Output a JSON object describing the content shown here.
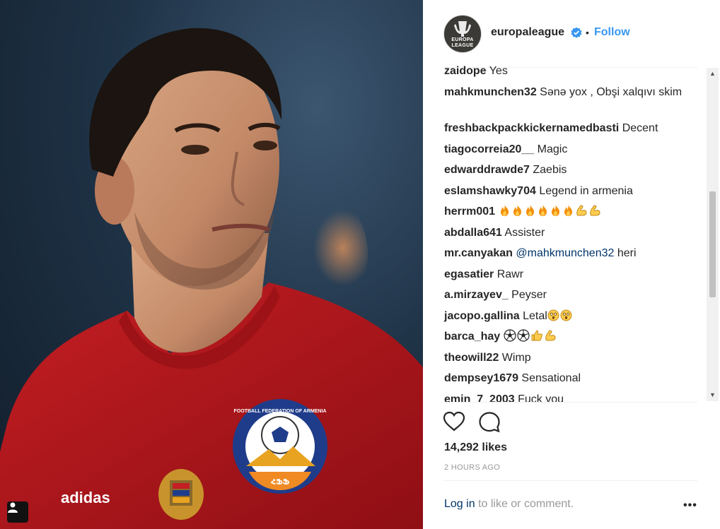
{
  "post": {
    "username": "europaleague",
    "avatar_text": [
      "EUROPA",
      "LEAGUE"
    ],
    "separator": "•",
    "follow_label": "Follow",
    "likes": "14,292 likes",
    "time": "2 HOURS AGO",
    "login_link": "Log in",
    "login_rest": " to like or comment.",
    "more_label": "•••"
  },
  "comments": [
    {
      "user": "zaidope",
      "text": " Yes"
    },
    {
      "user": "mahkmunchen32",
      "text": " Sənə yox , Obşi xalqıvı skim"
    },
    {
      "user": "freshbackpackkickernamedbasti",
      "text": " Decent"
    },
    {
      "user": "tiagocorreia20__",
      "text": " Magic"
    },
    {
      "user": "edwarddrawde7",
      "text": " Zaebis"
    },
    {
      "user": "eslamshawky704",
      "text": " Legend in armenia"
    },
    {
      "user": "herrm001",
      "text": " ",
      "emojis": [
        "fire",
        "fire",
        "fire",
        "fire",
        "fire",
        "fire",
        "muscle",
        "muscle"
      ]
    },
    {
      "user": "abdalla641",
      "text": " Assister"
    },
    {
      "user": "mr.canyakan",
      "mention": " @mahkmunchen32",
      "text": " heri"
    },
    {
      "user": "egasatier",
      "text": " Rawr"
    },
    {
      "user": "a.mirzayev_",
      "text": " Peyser"
    },
    {
      "user": "jacopo.gallina",
      "text": " Letal",
      "emojis": [
        "astonished",
        "astonished"
      ]
    },
    {
      "user": "barca_hay",
      "text": " ",
      "emojis": [
        "soccer",
        "soccer",
        "thumbs-up",
        "muscle"
      ]
    },
    {
      "user": "theowill22",
      "text": " Wimp"
    },
    {
      "user": "dempsey1679",
      "text": " Sensational"
    },
    {
      "user": "emin_7_2003",
      "text": " Fuck you"
    }
  ],
  "jersey": {
    "brand": "adidas",
    "badge_text": "FOOTBALL FEDERATION OF ARMENIA",
    "badge_initials": "ՀՖՖ"
  },
  "colors": {
    "accent": "#3897f0",
    "link": "#003569",
    "jersey_red": "#b3161b"
  },
  "icons": [
    "heart-icon",
    "comment-icon",
    "verified-badge-icon",
    "user-tag-icon"
  ]
}
